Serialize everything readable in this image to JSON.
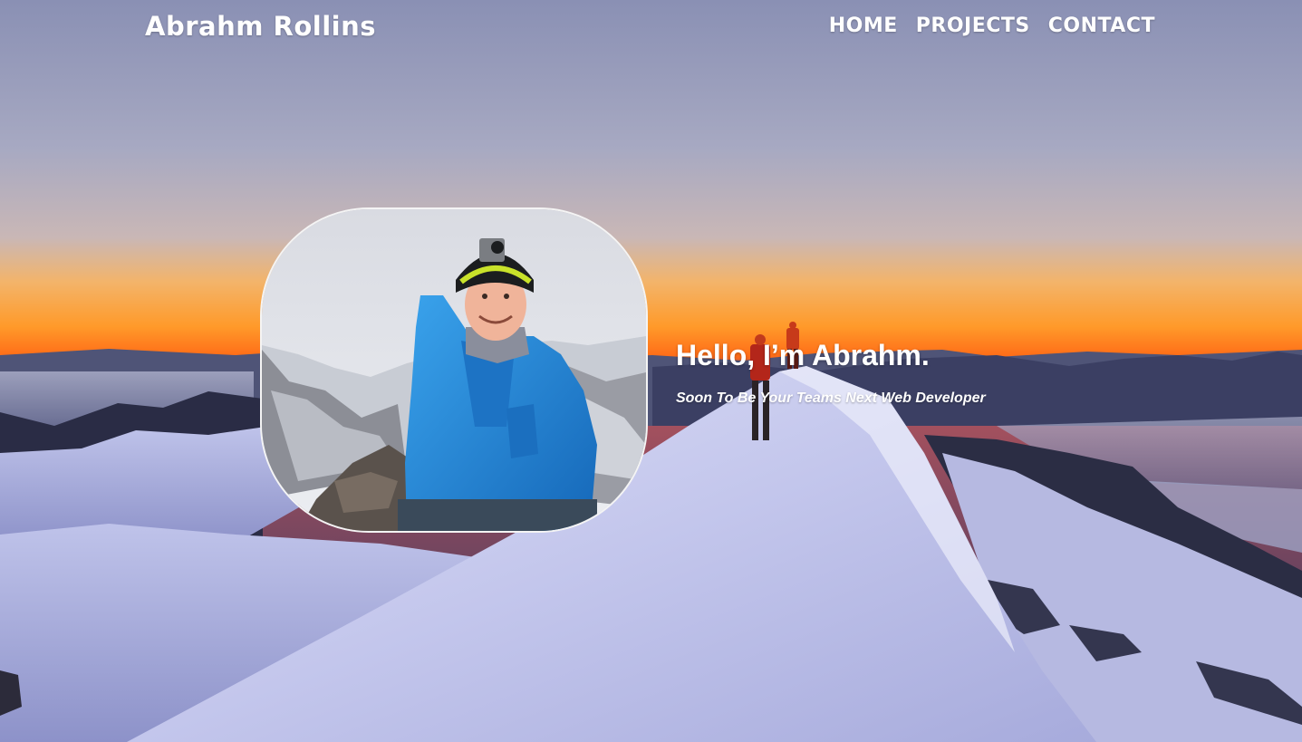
{
  "header": {
    "brand": "Abrahm Rollins",
    "nav": [
      "HOME",
      "PROJECTS",
      "CONTACT"
    ]
  },
  "hero": {
    "headline": "Hello, I’m Abrahm.",
    "tagline": "Soon To Be Your Teams Next Web Developer"
  },
  "colors": {
    "text": "#ffffff",
    "sky_top": "#8a90b4",
    "horizon": "#ff8a1e",
    "snow": "#c9cdf0",
    "jacket": "#1e86d6"
  }
}
